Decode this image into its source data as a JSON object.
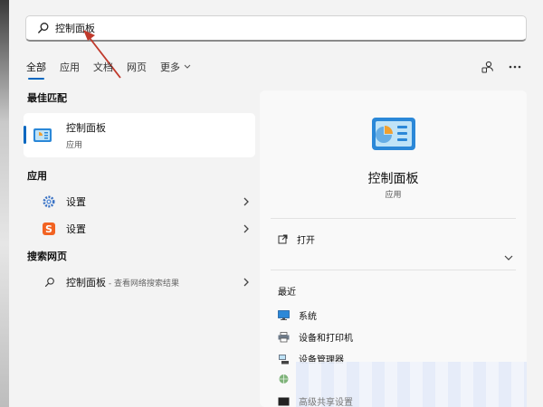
{
  "search": {
    "value": "控制面板"
  },
  "tabs": [
    {
      "label": "全部"
    },
    {
      "label": "应用"
    },
    {
      "label": "文档"
    },
    {
      "label": "网页"
    },
    {
      "label": "更多"
    }
  ],
  "best_match": {
    "section": "最佳匹配",
    "title": "控制面板",
    "subtitle": "应用"
  },
  "apps": {
    "section": "应用",
    "items": [
      {
        "label": "设置",
        "icon": "gear-icon"
      },
      {
        "label": "设置",
        "icon": "sogou-s-icon"
      }
    ]
  },
  "web": {
    "section": "搜索网页",
    "label": "控制面板",
    "sub": " - 查看网络搜索结果"
  },
  "detail": {
    "name": "控制面板",
    "type": "应用",
    "open_label": "打开",
    "recent_title": "最近",
    "recent": [
      {
        "label": "系统"
      },
      {
        "label": "设备和打印机"
      },
      {
        "label": "设备管理器"
      },
      {
        "label": "高级共享设置"
      }
    ]
  },
  "colors": {
    "accent": "#0067c0",
    "panel": "#f3f3f3",
    "arrow": "#c0392b"
  }
}
